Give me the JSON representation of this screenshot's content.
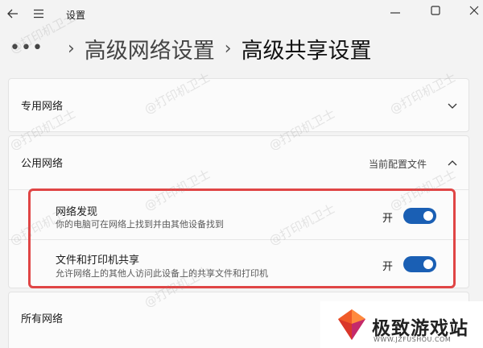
{
  "window": {
    "title": "设置"
  },
  "breadcrumb": {
    "more": "•••",
    "sep": "›",
    "items": [
      "高级网络设置",
      "高级共享设置"
    ]
  },
  "sections": {
    "private": {
      "title": "专用网络",
      "expanded": false
    },
    "public": {
      "title": "公用网络",
      "status": "当前配置文件",
      "expanded": true,
      "rows": [
        {
          "title": "网络发现",
          "description": "你的电脑可在网络上找到并由其他设备找到",
          "toggle_label": "开",
          "on": true
        },
        {
          "title": "文件和打印机共享",
          "description": "允许网络上的其他人访问此设备上的共享文件和打印机",
          "toggle_label": "开",
          "on": true
        }
      ]
    },
    "all": {
      "title": "所有网络"
    }
  },
  "watermark": "@打印机卫士",
  "brand": {
    "name": "极致游戏站",
    "url": "WWW.JZFUSHOU.COM"
  },
  "colors": {
    "toggle_on": "#1a5fb4",
    "highlight": "#e04545",
    "background": "#f3f3f3"
  }
}
